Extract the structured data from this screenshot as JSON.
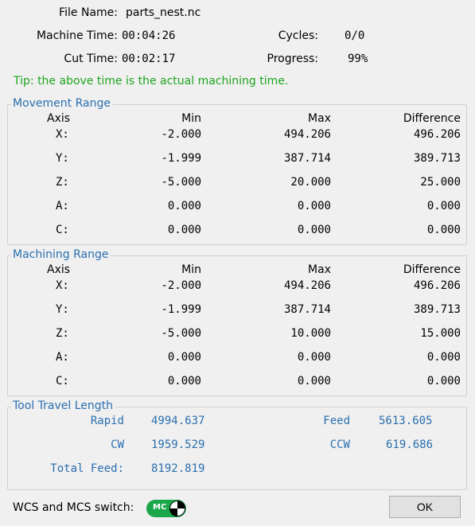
{
  "info": {
    "file_name_label": "File Name:",
    "file_name": "parts_nest.nc",
    "machine_time_label": "Machine Time:",
    "machine_time": "00:04:26",
    "cycles_label": "Cycles:",
    "cycles": "0/0",
    "cut_time_label": "Cut Time:",
    "cut_time": "00:02:17",
    "progress_label": "Progress:",
    "progress": "99%",
    "tip": "Tip: the above time is the actual machining time."
  },
  "movement_range": {
    "title": "Movement Range",
    "headers": [
      "Axis",
      "Min",
      "Max",
      "Difference"
    ],
    "rows": [
      {
        "axis": "X:",
        "min": "-2.000",
        "max": "494.206",
        "diff": "496.206"
      },
      {
        "axis": "Y:",
        "min": "-1.999",
        "max": "387.714",
        "diff": "389.713"
      },
      {
        "axis": "Z:",
        "min": "-5.000",
        "max": "20.000",
        "diff": "25.000"
      },
      {
        "axis": "A:",
        "min": "0.000",
        "max": "0.000",
        "diff": "0.000"
      },
      {
        "axis": "C:",
        "min": "0.000",
        "max": "0.000",
        "diff": "0.000"
      }
    ]
  },
  "machining_range": {
    "title": "Machining Range",
    "headers": [
      "Axis",
      "Min",
      "Max",
      "Difference"
    ],
    "rows": [
      {
        "axis": "X:",
        "min": "-2.000",
        "max": "494.206",
        "diff": "496.206"
      },
      {
        "axis": "Y:",
        "min": "-1.999",
        "max": "387.714",
        "diff": "389.713"
      },
      {
        "axis": "Z:",
        "min": "-5.000",
        "max": "10.000",
        "diff": "15.000"
      },
      {
        "axis": "A:",
        "min": "0.000",
        "max": "0.000",
        "diff": "0.000"
      },
      {
        "axis": "C:",
        "min": "0.000",
        "max": "0.000",
        "diff": "0.000"
      }
    ]
  },
  "tool_travel": {
    "title": "Tool Travel Length",
    "rapid_label": "Rapid",
    "rapid": "4994.637",
    "feed_label": "Feed",
    "feed": "5613.605",
    "cw_label": "CW",
    "cw": "1959.529",
    "ccw_label": "CCW",
    "ccw": "619.686",
    "total_feed_label": "Total Feed:",
    "total_feed": "8192.819"
  },
  "footer": {
    "switch_label": "WCS and MCS switch:",
    "toggle_text": "MC",
    "toggle_icon": "wcs-mcs-toggle-icon",
    "ok_label": "OK"
  },
  "colors": {
    "accent_blue": "#2a6fb0",
    "tip_green": "#1fa31f",
    "toggle_green": "#1aa64a"
  }
}
